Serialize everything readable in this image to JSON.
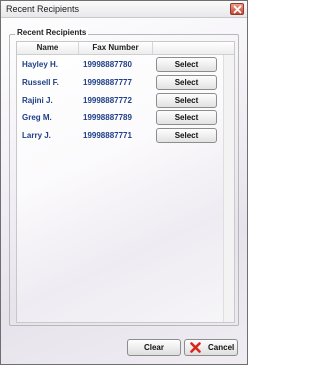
{
  "window": {
    "title": "Recent Recipients"
  },
  "group": {
    "label": "Recent Recipients"
  },
  "table": {
    "columns": [
      "Name",
      "Fax Number",
      ""
    ],
    "rows": [
      {
        "name": "Hayley H.",
        "fax": "19998887780",
        "action": "Select"
      },
      {
        "name": "Russell F.",
        "fax": "19998887777",
        "action": "Select"
      },
      {
        "name": "Rajini J.",
        "fax": "19998887772",
        "action": "Select"
      },
      {
        "name": "Greg M.",
        "fax": "19998887789",
        "action": "Select"
      },
      {
        "name": "Larry J.",
        "fax": "19998887771",
        "action": "Select"
      }
    ]
  },
  "buttons": {
    "clear": "Clear",
    "cancel": "Cancel"
  },
  "colors": {
    "link_text": "#1f3f87",
    "close_red": "#c9452f",
    "cancel_icon": "#d8261c"
  },
  "icons": {
    "close": "close-icon",
    "cancel": "x-icon"
  }
}
